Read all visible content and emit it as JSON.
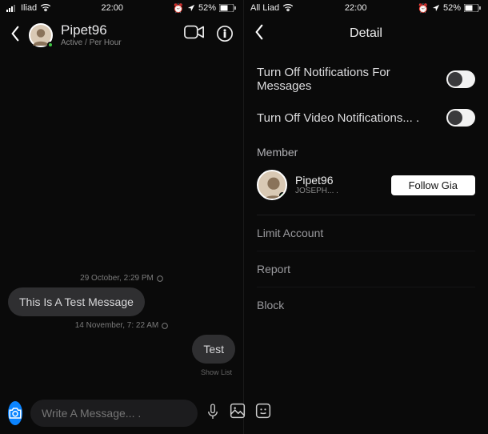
{
  "left": {
    "status": {
      "carrier": "Iliad",
      "time": "22:00",
      "battery_pct": "52%"
    },
    "header": {
      "name": "Pipet96",
      "sub": "Active / Per Hour"
    },
    "timeline": [
      {
        "type": "timestamp",
        "text": "29 October, 2:29 PM"
      },
      {
        "type": "bubble",
        "side": "left",
        "text": "This Is A Test Message"
      },
      {
        "type": "timestamp",
        "text": "14 November, 7: 22 AM"
      },
      {
        "type": "bubble",
        "side": "right",
        "text": "Test"
      },
      {
        "type": "received",
        "text": "Show List"
      }
    ],
    "composer": {
      "placeholder": "Write A Message... ."
    }
  },
  "right": {
    "status": {
      "carrier": "All Liad",
      "time": "22:00",
      "battery_pct": "52%"
    },
    "title": "Detail",
    "settings": [
      {
        "label": "Turn Off Notifications For Messages",
        "on": false
      },
      {
        "label": "Turn Off Video Notifications... .",
        "on": false
      }
    ],
    "member_section_label": "Member",
    "member": {
      "name": "Pipet96",
      "sub": "JOSEPH... .",
      "follow_label": "Follow Gia"
    },
    "actions": [
      "Limit Account",
      "Report",
      "Block"
    ]
  }
}
